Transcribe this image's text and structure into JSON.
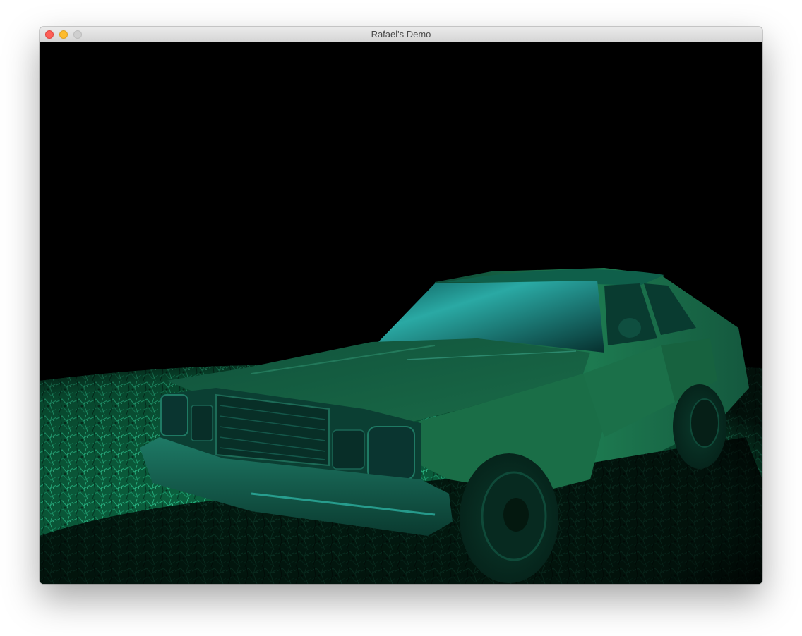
{
  "window": {
    "title": "Rafael's Demo",
    "buttons": {
      "close": {
        "icon": "close-icon",
        "color": "#fe5f57"
      },
      "minimize": {
        "icon": "minimize-icon",
        "color": "#febc2e"
      },
      "zoom": {
        "icon": "zoom-icon",
        "color": "#cfcfcf"
      }
    }
  },
  "scene": {
    "background": "#000000",
    "ground_color": "#0f8a5a",
    "car_color": "#1d6f4d",
    "highlight_color": "#2ec8c0"
  }
}
